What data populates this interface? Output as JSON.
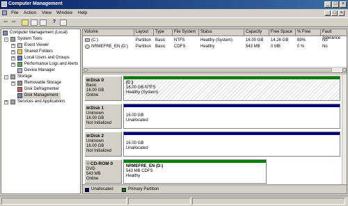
{
  "window": {
    "title": "Computer Management"
  },
  "menu": [
    "File",
    "Action",
    "View",
    "Window",
    "Help"
  ],
  "tree": {
    "root": "Computer Management (Local)",
    "system_tools": "System Tools",
    "event_viewer": "Event Viewer",
    "shared_folders": "Shared Folders",
    "local_users": "Local Users and Groups",
    "perf_logs": "Performance Logs and Alerts",
    "device_manager": "Device Manager",
    "storage": "Storage",
    "removable_storage": "Removable Storage",
    "disk_defrag": "Disk Defragmenter",
    "disk_management": "Disk Management",
    "services": "Services and Applications"
  },
  "volumes": {
    "headers": [
      "Volume",
      "Layout",
      "Type",
      "File System",
      "Status",
      "Capacity",
      "Free Space",
      "% Free",
      "Fault Tolerance"
    ],
    "rows": [
      [
        "(C:)",
        "Partition",
        "Basic",
        "NTFS",
        "Healthy (System)",
        "16.00 GB",
        "14.26 GB",
        "89%",
        "No"
      ],
      [
        "NRMEFRE_EN (D:)",
        "Partition",
        "Basic",
        "CDFS",
        "Healthy",
        "543 MB",
        "0 MB",
        "0 %",
        "No"
      ]
    ]
  },
  "disks": [
    {
      "name": "Disk 0",
      "l1": "Basic",
      "l2": "16.00 GB",
      "l3": "Online",
      "p1": "(C:)",
      "p2": "16.00 GB NTFS",
      "p3": "Healthy (System)"
    },
    {
      "name": "Disk 1",
      "l1": "Unknown",
      "l2": "16.00 GB",
      "l3": "Not Initialized",
      "p1": "",
      "p2": "16.00 GB",
      "p3": "Unallocated"
    },
    {
      "name": "Disk 2",
      "l1": "Unknown",
      "l2": "16.00 GB",
      "l3": "Not Initialized",
      "p1": "",
      "p2": "16.00 GB",
      "p3": "Unallocated"
    },
    {
      "name": "CD-ROM 0",
      "l1": "DVD",
      "l2": "543 MB",
      "l3": "Online",
      "p1": "NRMEFRE_EN (D:)",
      "p2": "543 MB CDFS",
      "p3": "Healthy"
    }
  ],
  "legend": {
    "unallocated": "Unallocated",
    "primary": "Primary Partition"
  },
  "colors": {
    "unallocated": "#000080",
    "primary": "#008000",
    "titlebar": "#0a246a"
  }
}
